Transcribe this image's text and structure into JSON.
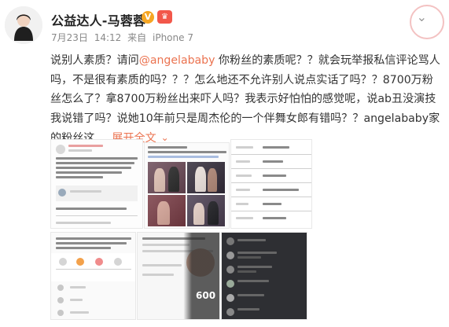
{
  "author": {
    "name": "公益达人-马蓉蓉",
    "verified_icon": "verified-badge-icon",
    "vip_icon": "vip-crown-icon",
    "avatar": "avatar-icon"
  },
  "meta": {
    "date": "7月23日",
    "time": "14:12",
    "source_prefix": "来自",
    "device": "iPhone 7"
  },
  "post": {
    "text_before_mention": "说别人素质？请问",
    "mention": "@angelababy",
    "text_after_mention": " 你粉丝的素质呢？？就会玩举报私信评论骂人吗，不是很有素质的吗？？？怎么地还不允许别人说点实话了吗？？8700万粉丝怎么了？拿8700万粉丝出来吓人吗？我表示好怕怕的感觉呢，说ab丑没演技我说错了吗？说她10年前只是周杰伦的一个伴舞女郎有错吗？？angelababy家的粉丝这",
    "ellipsis": " ...",
    "expand_label": "展开全文",
    "expand_icon": "chevron-down-icon"
  },
  "media": {
    "count": 6,
    "thumb6_overlay_text": "600"
  },
  "colors": {
    "link": "#eb7350",
    "text": "#333333",
    "meta": "#888888"
  }
}
